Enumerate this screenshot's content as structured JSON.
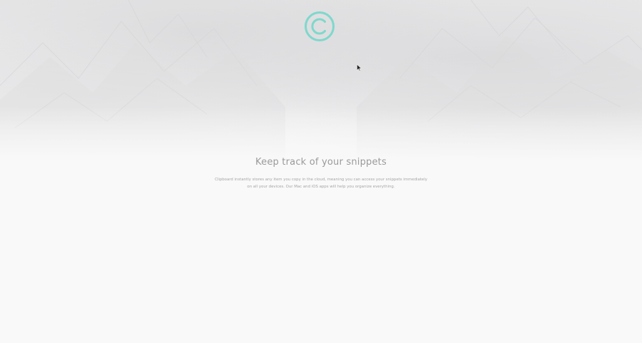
{
  "brand": {
    "logo_icon": "copyright-c-icon",
    "accent_color": "#7fd8cc"
  },
  "hero": {
    "title": "Keep track of your snippets",
    "description": "Clipboard instantly stores any item you copy in the cloud, meaning you can access your snippets immediately on all your devices. Our Mac and iOS apps will help you organize everything."
  }
}
